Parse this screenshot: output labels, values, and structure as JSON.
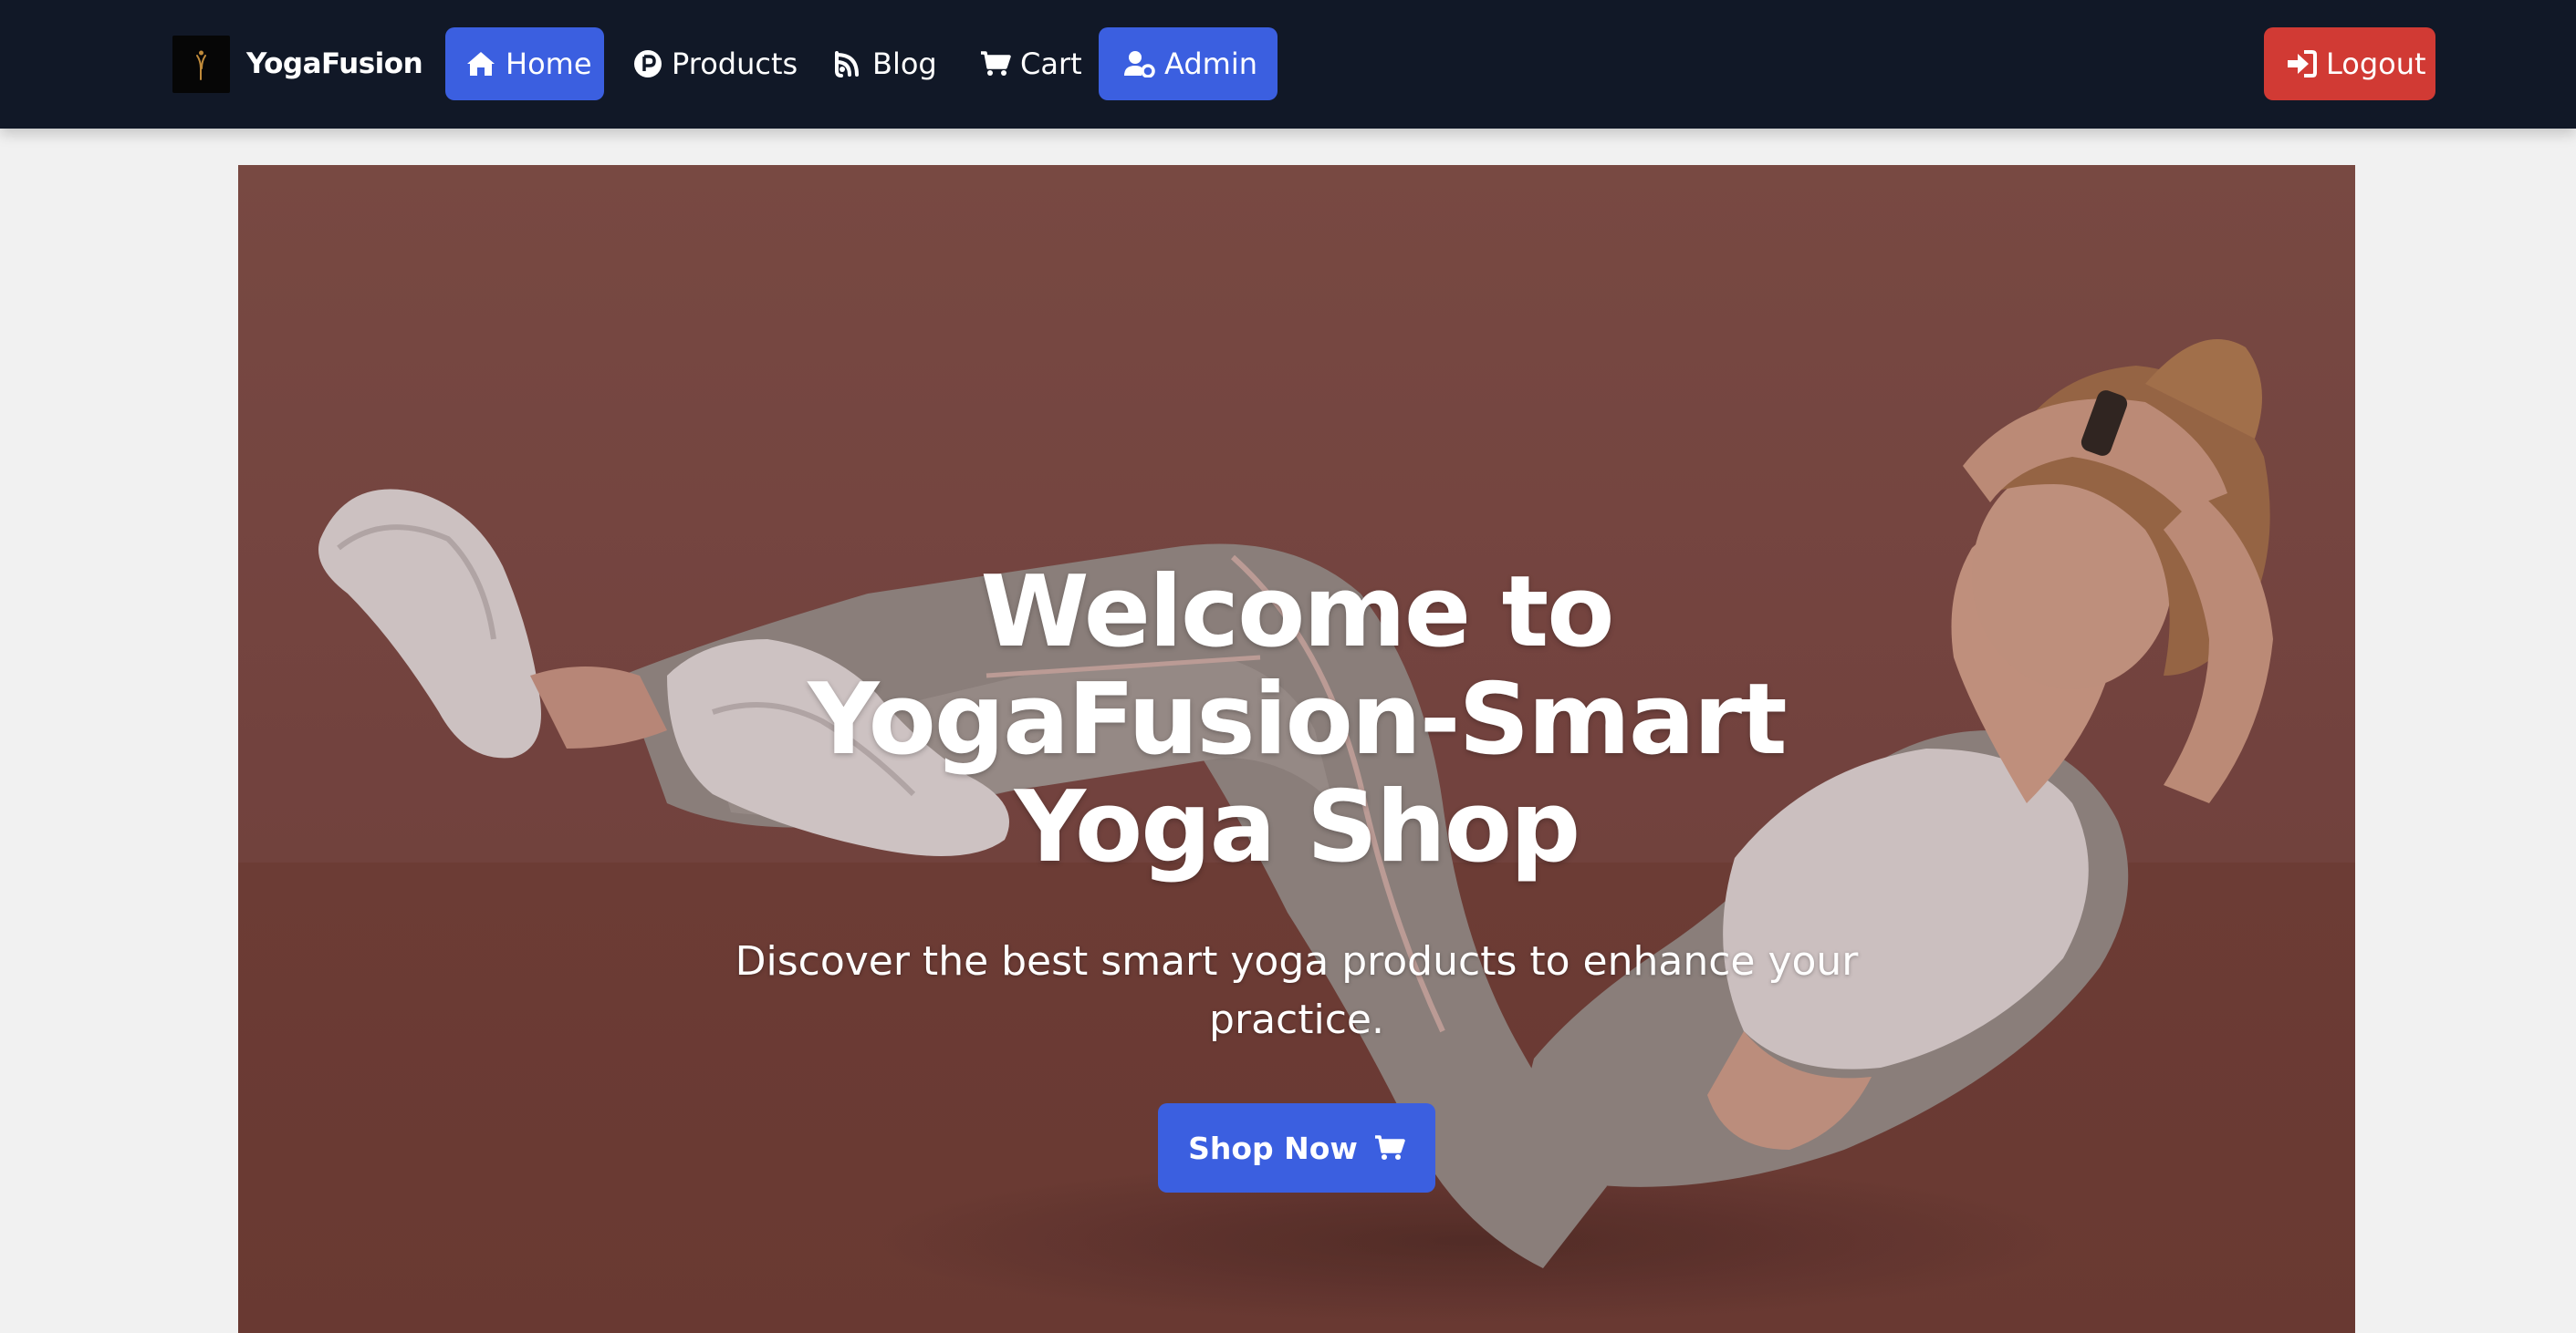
{
  "brand": {
    "name": "YogaFusion",
    "logo_icon": "yoga-figure-logo"
  },
  "nav": {
    "items": [
      {
        "label": "Home",
        "icon": "home-icon",
        "active": true
      },
      {
        "label": "Products",
        "icon": "p-circle-icon",
        "active": false
      },
      {
        "label": "Blog",
        "icon": "blog-feed-icon",
        "active": false
      },
      {
        "label": "Cart",
        "icon": "cart-icon",
        "active": false
      },
      {
        "label": "Admin",
        "icon": "user-gear-icon",
        "active": true
      }
    ],
    "logout_label": "Logout",
    "logout_icon": "sign-in-icon"
  },
  "hero": {
    "title": "Welcome to YogaFusion-Smart Yoga Shop",
    "subtitle": "Discover the best smart yoga products to enhance your practice.",
    "cta_label": "Shop Now",
    "cta_icon": "cart-icon"
  },
  "colors": {
    "navbar_bg": "#111827",
    "primary": "#3b5fe0",
    "danger": "#d13a34",
    "page_bg": "#f1f1f1",
    "hero_bg": "#7b4d47"
  }
}
